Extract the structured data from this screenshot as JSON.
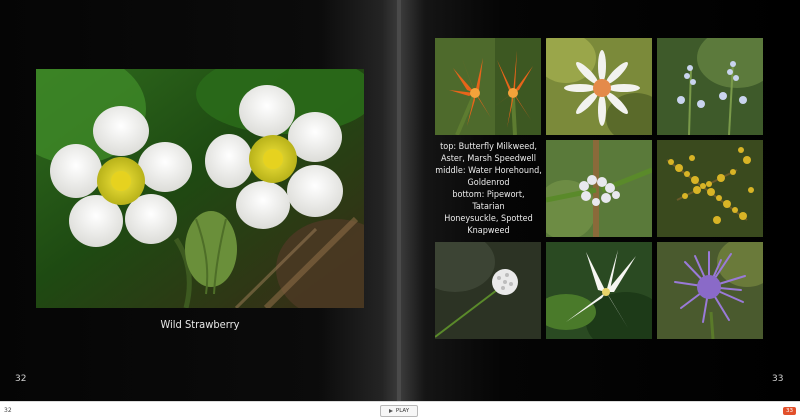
{
  "left_page": {
    "caption": "Wild Strawberry",
    "page_number": "32",
    "photo": "wild-strawberry-photo"
  },
  "right_page": {
    "caption": "top: Butterfly Milkweed,\nAster, Marsh Speedwell\nmiddle: Water Horehound,\nGoldenrod\nbottom: Pipewort, Tatarian\nHoneysuckle, Spotted\nKnapweed",
    "page_number": "33",
    "photos": [
      "butterfly-milkweed",
      "aster",
      "marsh-speedwell",
      "water-horehound",
      "goldenrod",
      "pipewort",
      "tatarian-honeysuckle",
      "spotted-knapweed"
    ]
  },
  "controls": {
    "play_label": "PLAY",
    "left_page_indicator": "32",
    "right_page_indicator": "33"
  },
  "colors": {
    "accent": "#e2502b",
    "page_background": "#000000"
  }
}
